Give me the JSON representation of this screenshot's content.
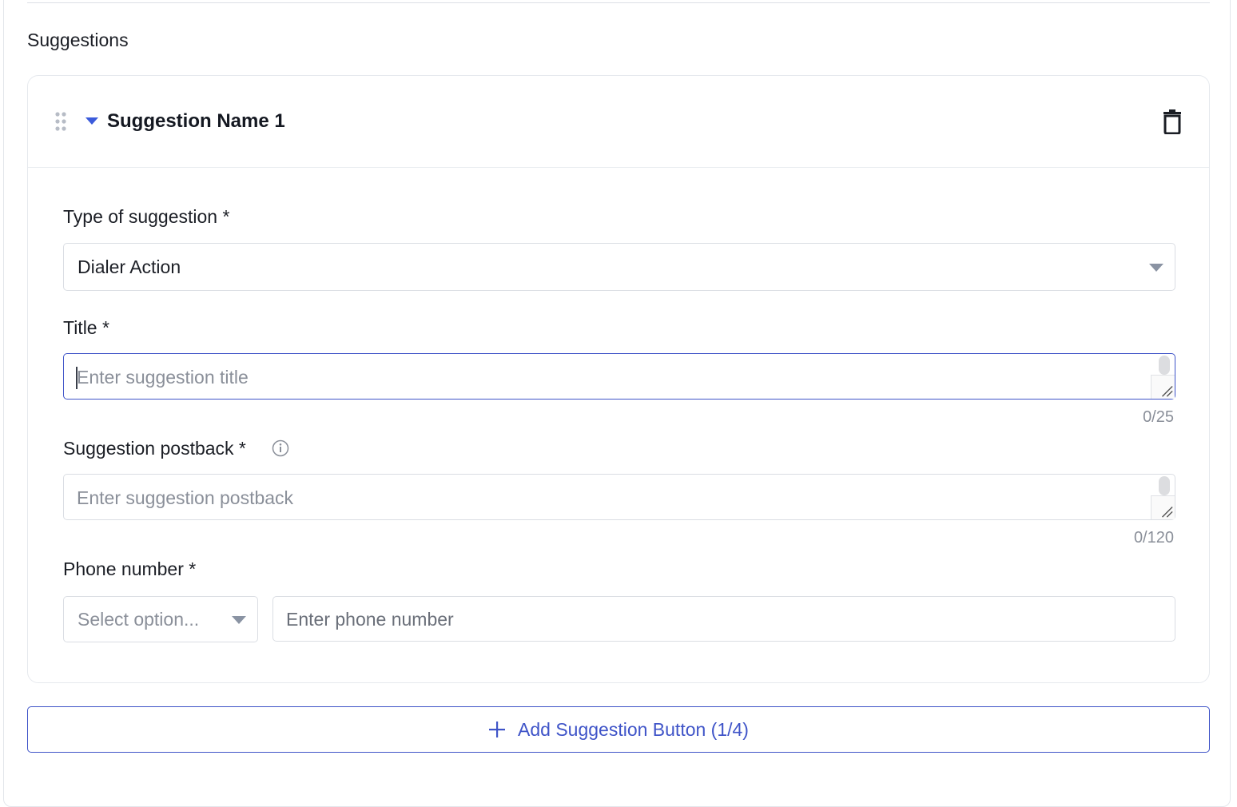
{
  "section": {
    "label": "Suggestions"
  },
  "card": {
    "title": "Suggestion Name 1",
    "icons": {
      "drag": "drag-handle-icon",
      "collapse": "caret-down-icon",
      "delete": "trash-icon"
    },
    "type_field": {
      "label": "Type of suggestion *",
      "value": "Dialer Action"
    },
    "title_field": {
      "label": "Title *",
      "placeholder": "Enter suggestion title",
      "counter": "0/25"
    },
    "postback_field": {
      "label": "Suggestion postback *",
      "placeholder": "Enter suggestion postback",
      "counter": "0/120"
    },
    "phone_field": {
      "label": "Phone number *",
      "country_placeholder": "Select option...",
      "placeholder": "Enter phone number"
    }
  },
  "add_button": {
    "label": "Add Suggestion Button (1/4)"
  },
  "colors": {
    "accent": "#3f54c8",
    "caret": "#3b5bdb",
    "muted": "#8a8f99",
    "border": "#dadde3"
  }
}
